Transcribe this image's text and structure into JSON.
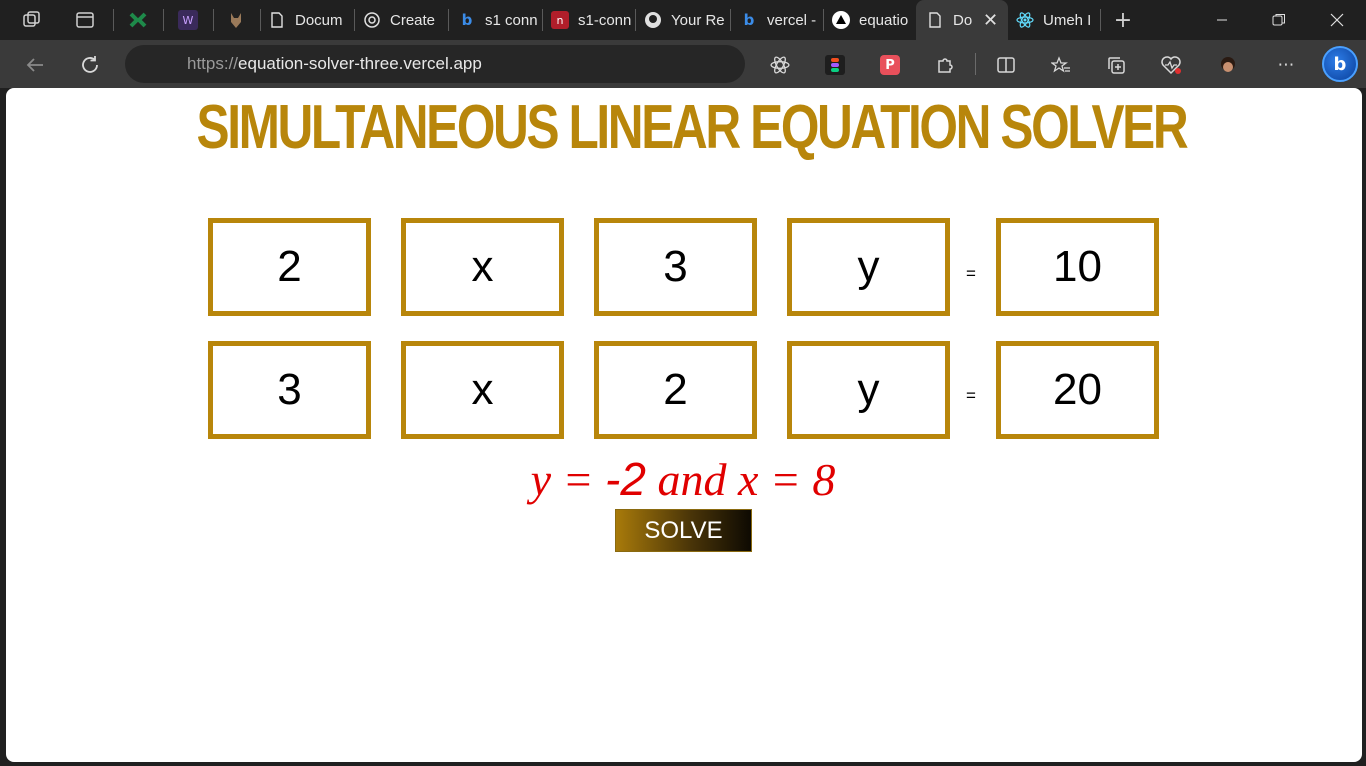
{
  "browser": {
    "tabs": [
      {
        "title": "Docum",
        "favicon": "document-icon"
      },
      {
        "title": "Create",
        "favicon": "chatgpt-icon"
      },
      {
        "title": "s1 conn",
        "favicon": "bing-icon"
      },
      {
        "title": "s1-conn",
        "favicon": "red-app-icon"
      },
      {
        "title": "Your Re",
        "favicon": "github-icon"
      },
      {
        "title": "vercel -",
        "favicon": "bing-icon"
      },
      {
        "title": "equatio",
        "favicon": "vercel-icon"
      },
      {
        "title": "Do",
        "favicon": "document-icon",
        "active": true
      },
      {
        "title": "Umeh I",
        "favicon": "react-icon"
      }
    ],
    "address_bar": {
      "protocol": "https://",
      "host": "equation-solver-three.vercel.app"
    }
  },
  "page": {
    "title": "SIMULTANEOUS LINEAR EQUATION SOLVER",
    "equations": [
      {
        "coef_x": "2",
        "var_x": "x",
        "coef_y": "3",
        "var_y": "y",
        "equals": "=",
        "constant": "10"
      },
      {
        "coef_x": "3",
        "var_x": "x",
        "coef_y": "2",
        "var_y": "y",
        "equals": "=",
        "constant": "20"
      }
    ],
    "result": {
      "y_label": "y = ",
      "y_value": "-2",
      "joiner": " and x = ",
      "x_value": "8"
    },
    "solve_label": "SOLVE",
    "accent_color": "#b8860b",
    "result_color": "#e00000"
  }
}
